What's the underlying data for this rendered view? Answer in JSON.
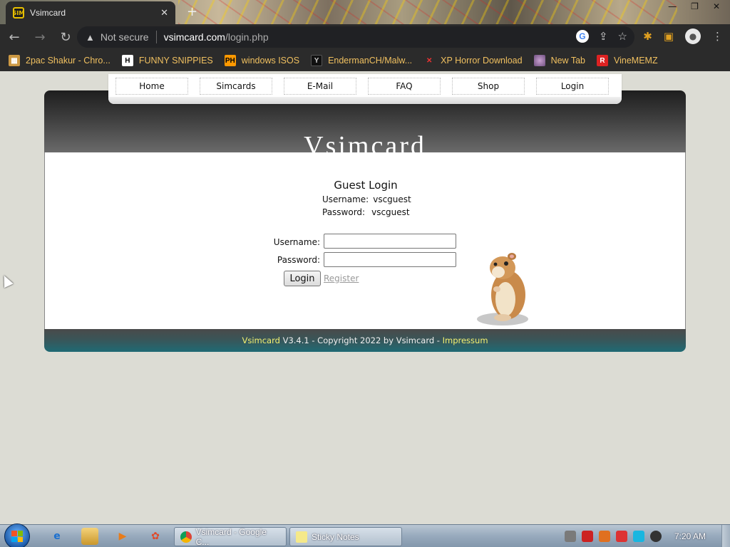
{
  "browser": {
    "tab_title": "Vsimcard",
    "security_label": "Not secure",
    "url_host": "vsimcard.com",
    "url_path": "/login.php",
    "bookmarks": [
      {
        "label": "2pac Shakur - Chro...",
        "icon": "shopping-bag-icon"
      },
      {
        "label": "FUNNY SNIPPIES",
        "icon": "h-letter-icon"
      },
      {
        "label": "windows ISOS",
        "icon": "ph-badge-icon"
      },
      {
        "label": "EndermanCH/Malw...",
        "icon": "yp-badge-icon"
      },
      {
        "label": "XP Horror Download",
        "icon": "x-mark-icon"
      },
      {
        "label": "New Tab",
        "icon": "globe-avatar-icon"
      },
      {
        "label": "VineMEMZ",
        "icon": "r-badge-icon"
      }
    ]
  },
  "site": {
    "nav": [
      "Home",
      "Simcards",
      "E-Mail",
      "FAQ",
      "Shop",
      "Login"
    ],
    "name": "Vsimcard",
    "guest_login": {
      "title": "Guest Login",
      "username_label": "Username:",
      "username_value": "vscguest",
      "password_label": "Password:",
      "password_value": "vscguest"
    },
    "form": {
      "username_label": "Username:",
      "password_label": "Password:",
      "username_value": "",
      "password_value": "",
      "login_button": "Login",
      "register_link": "Register"
    },
    "footer": {
      "brand": "Vsimcard",
      "text": " V3.4.1 - Copyright 2022 by Vsimcard - ",
      "impressum": "Impressum"
    },
    "mascot": "hamster-image"
  },
  "taskbar": {
    "tasks": [
      {
        "label": "Vsimcard - Google C...",
        "icon": "chrome-icon"
      },
      {
        "label": "Sticky Notes",
        "icon": "sticky-notes-icon"
      }
    ],
    "clock": "7:20 AM"
  },
  "colors": {
    "header_dark": "#1e1e1e",
    "footer_teal": "#1f6a74",
    "footer_highlight": "#f4f070",
    "bookmark_text": "#f0c060"
  }
}
